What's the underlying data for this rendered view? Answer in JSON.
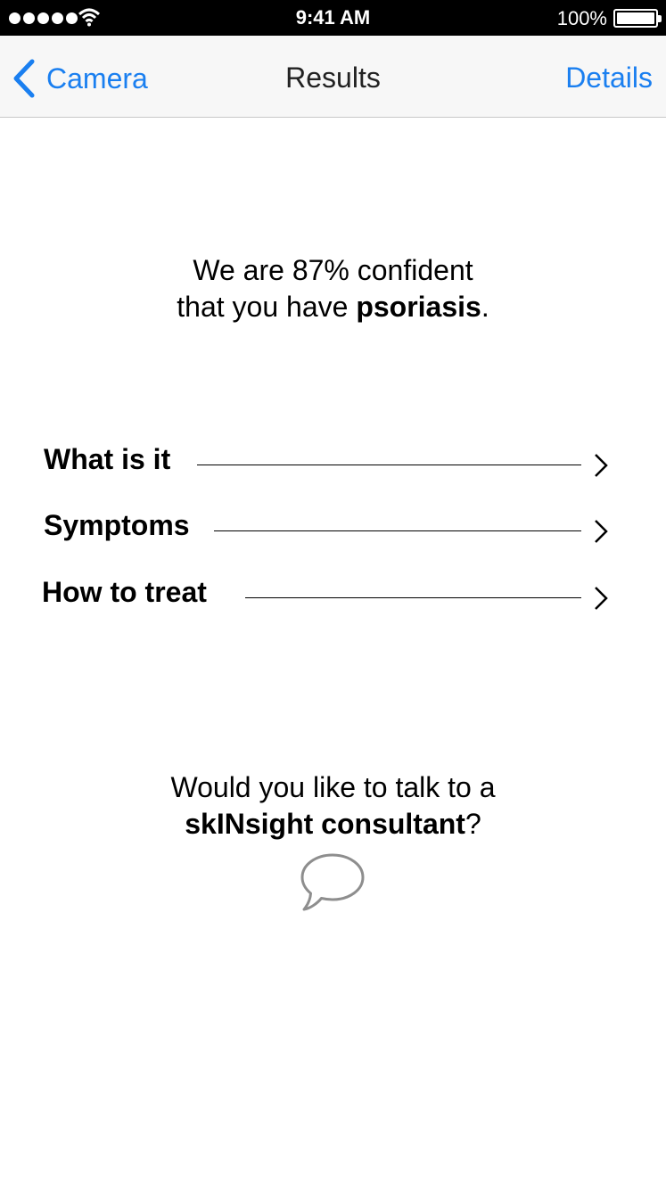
{
  "status_bar": {
    "time": "9:41 AM",
    "battery": "100%",
    "icons": [
      "signal-dots-icon",
      "wifi-icon",
      "battery-icon"
    ]
  },
  "nav": {
    "back_label": "Camera",
    "title": "Results",
    "right_label": "Details"
  },
  "result": {
    "line1": "We are 87% confident",
    "line2_prefix": "that you have ",
    "condition": "psoriasis",
    "line2_suffix": "."
  },
  "menu": {
    "items": [
      {
        "label": "What is it"
      },
      {
        "label": "Symptoms"
      },
      {
        "label": "How to treat"
      }
    ]
  },
  "consult": {
    "line1": "Would you like to talk to a",
    "name": "skINsight consultant",
    "suffix": "?",
    "icon": "chat-bubble-icon"
  },
  "colors": {
    "accent": "#1a7ff0",
    "status_bar_bg": "#000000",
    "nav_bg": "#f7f7f7",
    "chat_icon": "#8e8e8e"
  }
}
